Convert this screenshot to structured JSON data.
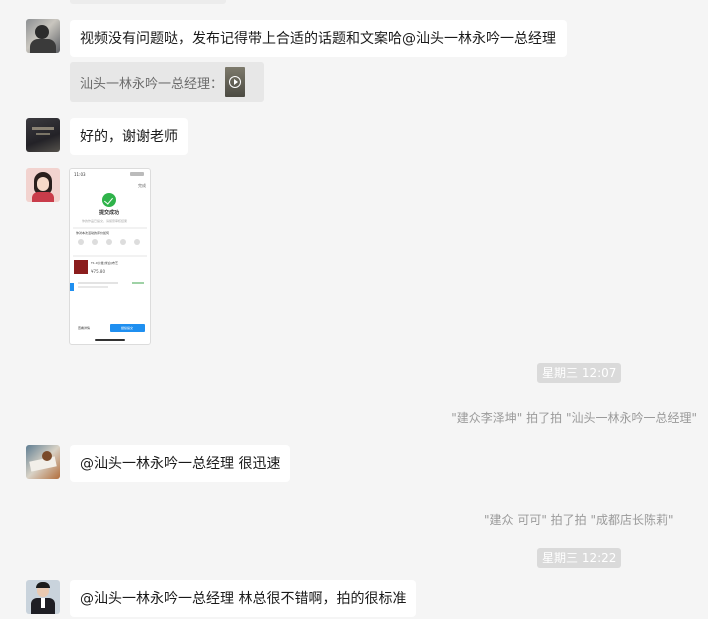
{
  "messages": {
    "m1": {
      "text": "视频没有问题哒，发布记得带上合适的话题和文案哈@汕头一林永吟一总经理"
    },
    "quote1": {
      "text": "汕头一林永吟一总经理："
    },
    "m2": {
      "text": "好的，谢谢老师"
    },
    "m3": {
      "text": "@汕头一林永吟一总经理 很迅速"
    },
    "m4": {
      "text": "@汕头一林永吟一总经理 林总很不错啊，拍的很标准"
    }
  },
  "system": {
    "time1": "星期三 12:07",
    "pat1": "\"建众李泽坤\" 拍了拍 \"汕头一林永吟一总经理\"",
    "pat2": "\"建众 可可\" 拍了拍 \"成都店长陈莉\"",
    "time2": "星期三 12:22"
  },
  "screenshot": {
    "status_time": "11:03",
    "top_right": "完成",
    "title": "提交成功",
    "subtitle": "你的作品已提交，请留意审核结果",
    "section": "你对本次活动的评价如何",
    "price": "¥75.80",
    "product": "T1.0沙发(米白)布艺",
    "btn_left": "查看详情",
    "btn_right": "继续提交"
  },
  "colors": {
    "background": "#f5f5f5",
    "bubble": "#ffffff",
    "quote": "#e7e7e7",
    "time_badge": "#dadada",
    "success_green": "#2fb34a",
    "button_blue": "#1f8ff0"
  }
}
